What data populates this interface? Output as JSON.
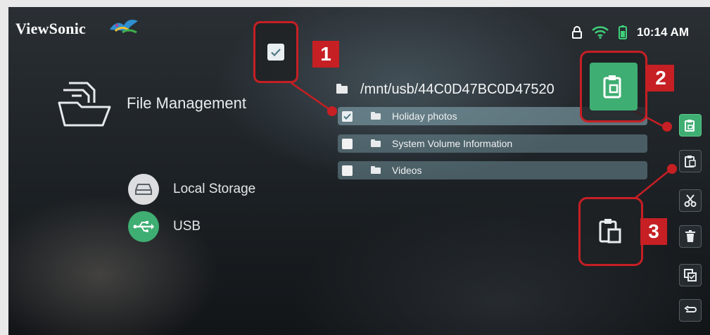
{
  "brand": {
    "name": "ViewSonic",
    "logo_icon": "bird-logo-icon"
  },
  "status_bar": {
    "time": "10:14 AM",
    "icons": [
      "lock-icon",
      "wifi-icon",
      "battery-icon"
    ]
  },
  "sidebar": {
    "title": "File Management",
    "title_icon": "folder-stack-icon",
    "items": [
      {
        "label": "Local Storage",
        "icon": "hard-drive-icon",
        "active": false
      },
      {
        "label": "USB",
        "icon": "usb-icon",
        "active": true
      }
    ]
  },
  "file_browser": {
    "path": "/mnt/usb/44C0D47BC0D47520",
    "items": [
      {
        "name": "Holiday photos",
        "checked": true
      },
      {
        "name": "System Volume Information",
        "checked": false
      },
      {
        "name": "Videos",
        "checked": false
      }
    ]
  },
  "actions_toolbar": {
    "buttons": [
      "copy-icon",
      "paste-icon",
      "cut-icon",
      "delete-icon",
      "select-all-icon",
      "back-icon"
    ]
  },
  "callouts": [
    {
      "number": "1",
      "icon": "checkbox-icon"
    },
    {
      "number": "2",
      "icon": "copy-icon"
    },
    {
      "number": "3",
      "icon": "paste-icon"
    }
  ],
  "colors": {
    "accent_green": "#3fae72",
    "callout_red": "#c61f24",
    "row_teal": "#6e8c96"
  }
}
